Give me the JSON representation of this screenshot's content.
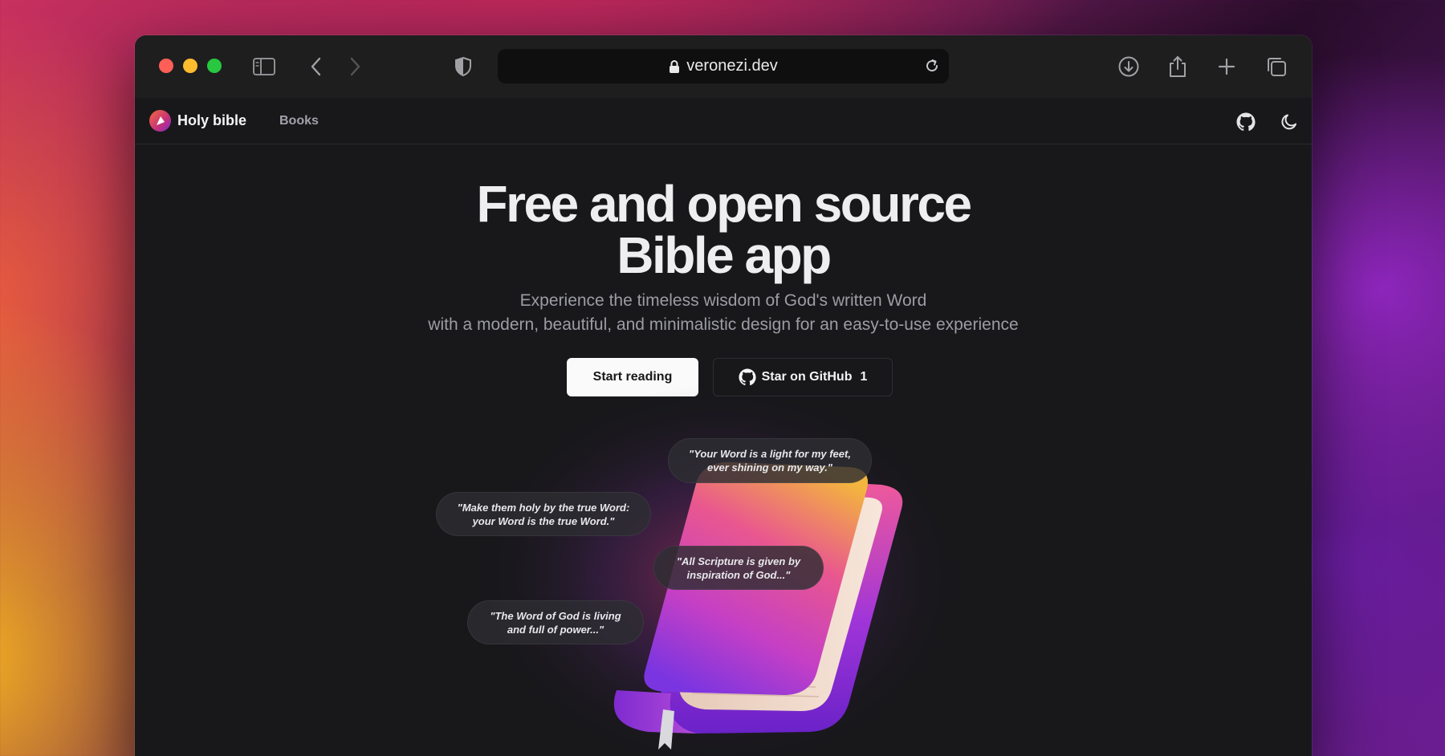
{
  "browser": {
    "url": "veronezi.dev",
    "icons": {
      "sidebar": "sidebar-icon",
      "back": "chevron-left-icon",
      "forward": "chevron-right-icon",
      "shield": "shield-icon",
      "lock": "lock-icon",
      "reload": "reload-icon",
      "download": "download-icon",
      "share": "share-icon",
      "new_tab": "plus-icon",
      "tabs": "tabs-overview-icon"
    }
  },
  "site": {
    "brand": "Holy bible",
    "nav": {
      "books": "Books"
    },
    "icons": {
      "github": "github-icon",
      "theme": "moon-icon"
    }
  },
  "hero": {
    "title_line1": "Free and open source",
    "title_line2": "Bible app",
    "subtitle_line1": "Experience the timeless wisdom of God's written Word",
    "subtitle_line2": "with a modern, beautiful, and minimalistic design for an easy-to-use experience",
    "primary_button": "Start reading",
    "secondary_button": "Star on GitHub",
    "star_count": "1"
  },
  "quotes": [
    {
      "line1": "\"Your Word is a light for my feet,",
      "line2": "ever shining on my way.\""
    },
    {
      "line1": "\"Make them holy by the true Word:",
      "line2": "your Word is the true Word.\""
    },
    {
      "line1": "\"All Scripture is given by",
      "line2": "inspiration of God...\""
    },
    {
      "line1": "\"The Word of God is living",
      "line2": "and full of power...\""
    }
  ],
  "colors": {
    "window_bg": "#18181b",
    "toolbar_bg": "#1e1e1f",
    "accent_gradient": [
      "#f5a623",
      "#e0407a",
      "#8a2be2"
    ]
  }
}
